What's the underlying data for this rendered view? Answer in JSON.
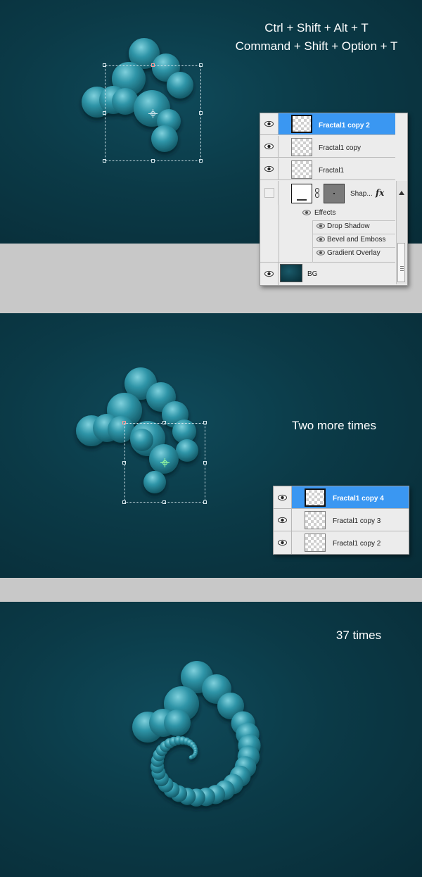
{
  "panel1": {
    "caption_line1": "Ctrl + Shift + Alt + T",
    "caption_line2": "Command + Shift + Option + T",
    "layers": {
      "rows": [
        {
          "name": "Fractal1 copy 2",
          "selected": true
        },
        {
          "name": "Fractal1 copy",
          "selected": false
        },
        {
          "name": "Fractal1",
          "selected": false
        }
      ],
      "shape_layer": {
        "name": "Shap...",
        "fx_label": "fx"
      },
      "effects_label": "Effects",
      "effects": [
        "Drop Shadow",
        "Bevel and Emboss",
        "Gradient Overlay"
      ],
      "bg_layer": {
        "name": "BG"
      }
    }
  },
  "panel2": {
    "caption": "Two more times",
    "layers": {
      "rows": [
        {
          "name": "Fractal1 copy 4",
          "selected": true
        },
        {
          "name": "Fractal1 copy 3",
          "selected": false
        },
        {
          "name": "Fractal1 copy 2",
          "selected": false
        }
      ]
    }
  },
  "panel3": {
    "caption": "37 times"
  },
  "colors": {
    "selection_blue": "#3a97f2",
    "background_teal": "#0b3a47",
    "bubble_teal": "#2a8ea0"
  }
}
